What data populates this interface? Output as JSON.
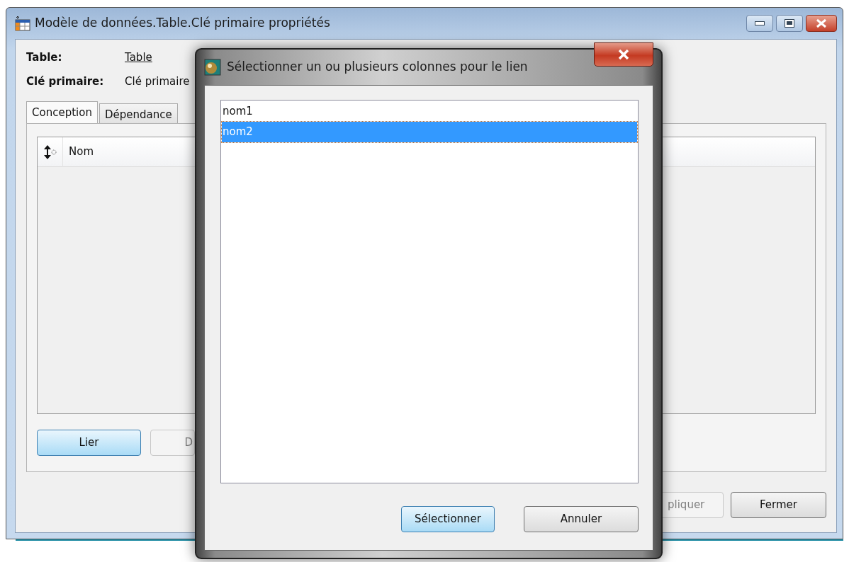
{
  "window": {
    "title": "Modèle de données.Table.Clé primaire propriétés"
  },
  "fields": [
    {
      "label": "Table:",
      "value": "Table",
      "kind": "link"
    },
    {
      "label": "Clé primaire:",
      "value": "Clé primaire",
      "kind": "text"
    }
  ],
  "tabs": [
    {
      "label": "Conception",
      "selected": true
    },
    {
      "label": "Dépendance",
      "selected": false
    }
  ],
  "grid": {
    "columns": [
      "Nom"
    ]
  },
  "panel_buttons": [
    {
      "label": "Lier",
      "disabled": false,
      "default": true
    },
    {
      "label": "D",
      "disabled": true,
      "default": false
    }
  ],
  "footer_buttons": [
    {
      "label": "pliquer",
      "disabled": true,
      "default": false
    },
    {
      "label": "Fermer",
      "disabled": false,
      "default": false
    }
  ],
  "dialog": {
    "title": "Sélectionner un ou plusieurs colonnes pour le lien",
    "items": [
      {
        "label": "nom1",
        "selected": false
      },
      {
        "label": "nom2",
        "selected": true
      }
    ],
    "buttons": [
      {
        "label": "Sélectionner",
        "default": true
      },
      {
        "label": "Annuler",
        "default": false
      }
    ]
  }
}
